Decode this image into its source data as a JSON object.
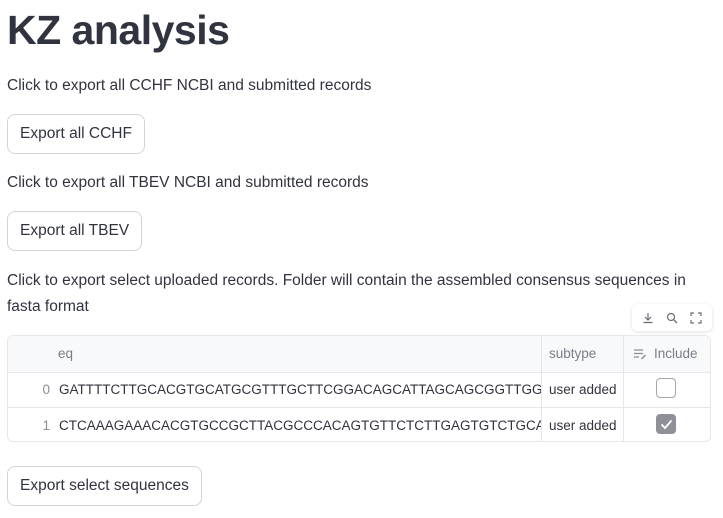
{
  "page": {
    "title": "KZ analysis",
    "cchf_text": "Click to export all CCHF NCBI and submitted records",
    "cchf_button": "Export all CCHF",
    "tbev_text": "Click to export all TBEV NCBI and submitted records",
    "tbev_button": "Export all TBEV",
    "select_text": "Click to export select uploaded records. Folder will contain the assembled consensus sequences in fasta format",
    "export_select_button": "Export select sequences"
  },
  "toolbar": {
    "icons": [
      "download-icon",
      "search-icon",
      "fullscreen-icon"
    ]
  },
  "table": {
    "columns": [
      "eq",
      "subtype",
      "Include"
    ],
    "rows": [
      {
        "index": "0",
        "seq": "GATTTTCTTGCACGTGCATGCGTTTGCTTCGGACAGCATTAGCAGCGGTTGGTTTGAAAGAGAAA",
        "subtype": "user added",
        "include": false
      },
      {
        "index": "1",
        "seq": "CTCAAAGAAACACGTGCCGCTTACGCCCACAGTGTTCTCTTGAGTGTCTGCAAAATGGAAAACAA",
        "subtype": "user added",
        "include": true
      }
    ]
  },
  "colors": {
    "text": "#31333f",
    "border": "#e6e7ea",
    "muted": "#7a7d87",
    "checked": "#8f9198"
  }
}
